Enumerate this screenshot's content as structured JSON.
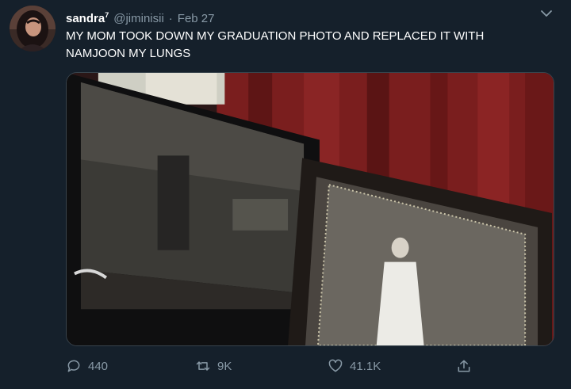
{
  "tweet": {
    "display_name": "sandra",
    "name_suffix": "7",
    "handle": "@jiminisii",
    "separator": "·",
    "timestamp": "Feb 27",
    "text": "MY MOM TOOK DOWN MY GRADUATION PHOTO AND REPLACED IT WITH\nNAMJOON MY LUNGS"
  },
  "actions": {
    "replies": "440",
    "retweets": "9K",
    "likes": "41.1K"
  },
  "icons": {
    "reply": "comment-bubble-icon",
    "retweet": "retweet-arrows-icon",
    "like": "heart-icon",
    "share": "share-upload-icon",
    "menu": "chevron-down-icon"
  },
  "colors": {
    "background": "#15202b",
    "text": "#ffffff",
    "secondary_text": "#8899a6",
    "border": "#38444d"
  }
}
